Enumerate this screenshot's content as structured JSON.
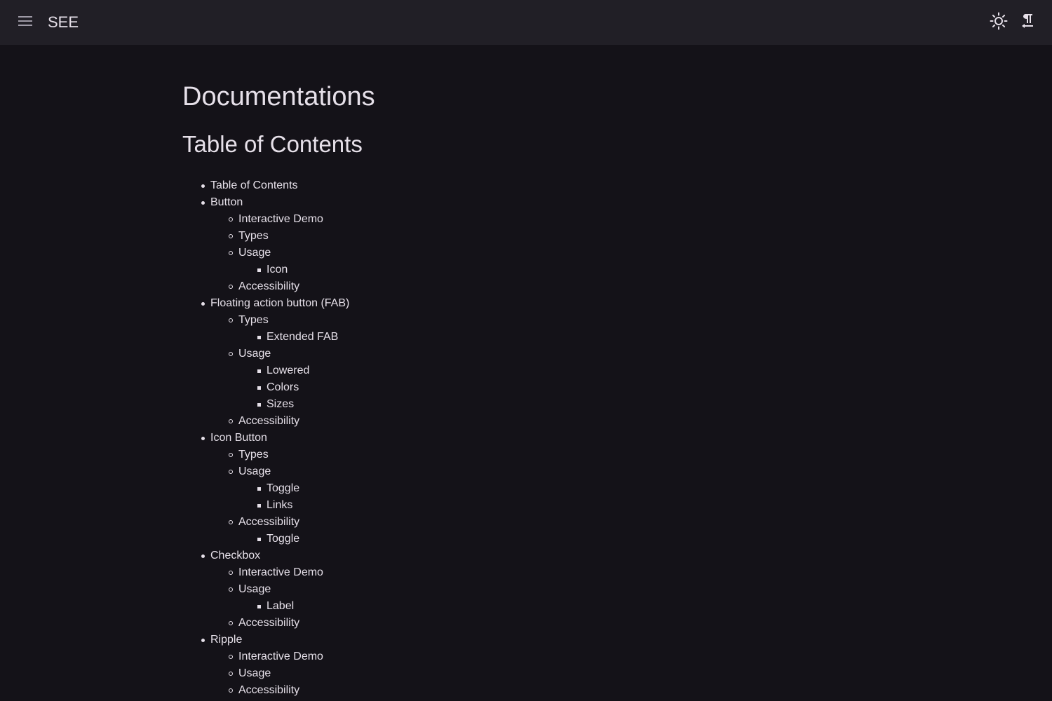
{
  "header": {
    "menu_icon": "menu-icon",
    "title": "SEE",
    "theme_icon": "light-mode-icon",
    "direction_icon": "text-direction-icon"
  },
  "main": {
    "page_title": "Documentations",
    "toc_title": "Table of Contents",
    "toc": [
      {
        "level": 0,
        "label": "Table of Contents"
      },
      {
        "level": 0,
        "label": "Button"
      },
      {
        "level": 1,
        "label": "Interactive Demo"
      },
      {
        "level": 1,
        "label": "Types"
      },
      {
        "level": 1,
        "label": "Usage"
      },
      {
        "level": 2,
        "label": "Icon"
      },
      {
        "level": 1,
        "label": "Accessibility"
      },
      {
        "level": 0,
        "label": "Floating action button (FAB)"
      },
      {
        "level": 1,
        "label": "Types"
      },
      {
        "level": 2,
        "label": "Extended FAB"
      },
      {
        "level": 1,
        "label": "Usage"
      },
      {
        "level": 2,
        "label": "Lowered"
      },
      {
        "level": 2,
        "label": "Colors"
      },
      {
        "level": 2,
        "label": "Sizes"
      },
      {
        "level": 1,
        "label": "Accessibility"
      },
      {
        "level": 0,
        "label": "Icon Button"
      },
      {
        "level": 1,
        "label": "Types"
      },
      {
        "level": 1,
        "label": "Usage"
      },
      {
        "level": 2,
        "label": "Toggle"
      },
      {
        "level": 2,
        "label": "Links"
      },
      {
        "level": 1,
        "label": "Accessibility"
      },
      {
        "level": 2,
        "label": "Toggle"
      },
      {
        "level": 0,
        "label": "Checkbox"
      },
      {
        "level": 1,
        "label": "Interactive Demo"
      },
      {
        "level": 1,
        "label": "Usage"
      },
      {
        "level": 2,
        "label": "Label"
      },
      {
        "level": 1,
        "label": "Accessibility"
      },
      {
        "level": 0,
        "label": "Ripple"
      },
      {
        "level": 1,
        "label": "Interactive Demo"
      },
      {
        "level": 1,
        "label": "Usage"
      },
      {
        "level": 1,
        "label": "Accessibility"
      }
    ]
  },
  "colors": {
    "background": "#141218",
    "topbar": "#211f26",
    "text": "#e6e0e9",
    "icon": "#cac4d0"
  }
}
